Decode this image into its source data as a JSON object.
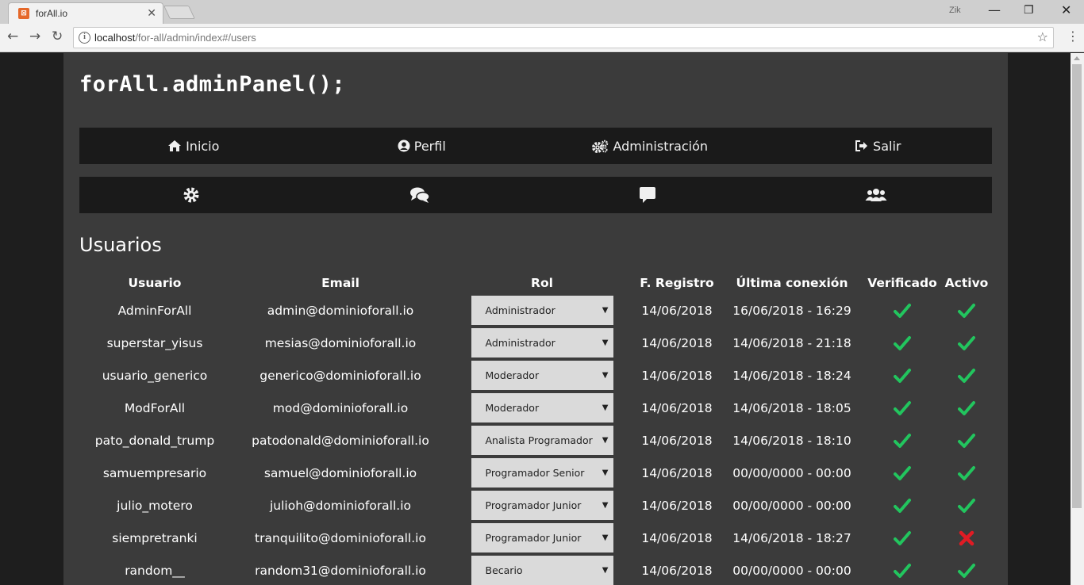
{
  "browser": {
    "tab_title": "forAll.io",
    "profile_name": "Zik",
    "url_host": "localhost",
    "url_path": "/for-all/admin/index#/users"
  },
  "page": {
    "brand": "forAll.adminPanel();",
    "nav": [
      {
        "label": "Inicio",
        "icon": "home-icon"
      },
      {
        "label": "Perfil",
        "icon": "user-circle-icon"
      },
      {
        "label": "Administración",
        "icon": "cogs-icon"
      },
      {
        "label": "Salir",
        "icon": "sign-out-icon"
      }
    ],
    "subnav": [
      {
        "icon": "gear-icon"
      },
      {
        "icon": "comments-icon"
      },
      {
        "icon": "comment-icon"
      },
      {
        "icon": "users-icon"
      }
    ],
    "section_title": "Usuarios",
    "columns": [
      "Usuario",
      "Email",
      "Rol",
      "F. Registro",
      "Última conexión",
      "Verificado",
      "Activo"
    ],
    "users": [
      {
        "username": "AdminForAll",
        "email": "admin@dominioforall.io",
        "role": "Administrador",
        "registered": "14/06/2018",
        "last_login": "16/06/2018 - 16:29",
        "verified": true,
        "active": true
      },
      {
        "username": "superstar_yisus",
        "email": "mesias@dominioforall.io",
        "role": "Administrador",
        "registered": "14/06/2018",
        "last_login": "14/06/2018 - 21:18",
        "verified": true,
        "active": true
      },
      {
        "username": "usuario_generico",
        "email": "generico@dominioforall.io",
        "role": "Moderador",
        "registered": "14/06/2018",
        "last_login": "14/06/2018 - 18:24",
        "verified": true,
        "active": true
      },
      {
        "username": "ModForAll",
        "email": "mod@dominioforall.io",
        "role": "Moderador",
        "registered": "14/06/2018",
        "last_login": "14/06/2018 - 18:05",
        "verified": true,
        "active": true
      },
      {
        "username": "pato_donald_trump",
        "email": "patodonald@dominioforall.io",
        "role": "Analista Programador",
        "registered": "14/06/2018",
        "last_login": "14/06/2018 - 18:10",
        "verified": true,
        "active": true
      },
      {
        "username": "samuempresario",
        "email": "samuel@dominioforall.io",
        "role": "Programador Senior",
        "registered": "14/06/2018",
        "last_login": "00/00/0000 - 00:00",
        "verified": true,
        "active": true
      },
      {
        "username": "julio_motero",
        "email": "julioh@dominioforall.io",
        "role": "Programador Junior",
        "registered": "14/06/2018",
        "last_login": "00/00/0000 - 00:00",
        "verified": true,
        "active": true
      },
      {
        "username": "siempretranki",
        "email": "tranquilito@dominioforall.io",
        "role": "Programador Junior",
        "registered": "14/06/2018",
        "last_login": "14/06/2018 - 18:27",
        "verified": true,
        "active": false
      },
      {
        "username": "random__",
        "email": "random31@dominioforall.io",
        "role": "Becario",
        "registered": "14/06/2018",
        "last_login": "00/00/0000 - 00:00",
        "verified": true,
        "active": true
      }
    ],
    "colors": {
      "username": "#e0338f",
      "check": "#22c55e",
      "cross": "#e01b24",
      "nav_bg": "#1a1a1a",
      "panel_bg": "#3b3b3b"
    }
  }
}
